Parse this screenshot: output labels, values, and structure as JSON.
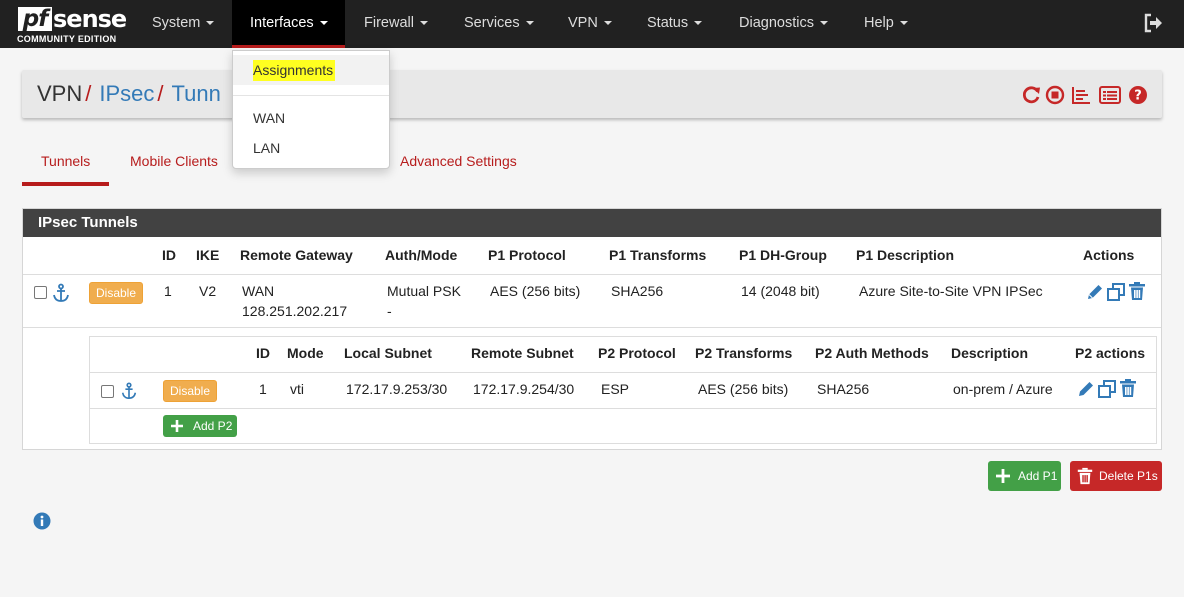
{
  "navbar": {
    "logo": {
      "mark": "pf",
      "word": "sense",
      "edition": "COMMUNITY EDITION"
    },
    "items": [
      {
        "label": "System"
      },
      {
        "label": "Interfaces"
      },
      {
        "label": "Firewall"
      },
      {
        "label": "Services"
      },
      {
        "label": "VPN"
      },
      {
        "label": "Status"
      },
      {
        "label": "Diagnostics"
      },
      {
        "label": "Help"
      }
    ],
    "active": "Interfaces",
    "logout_icon": "logout-icon"
  },
  "dropdown": {
    "items": [
      {
        "label": "Assignments",
        "highlighted": true
      },
      {
        "label": "WAN"
      },
      {
        "label": "LAN"
      }
    ]
  },
  "breadcrumb": {
    "parts": [
      "VPN",
      "IPsec",
      "Tunn"
    ],
    "separator": "/",
    "icons": [
      "reload-icon",
      "stop-icon",
      "chart-icon",
      "list-icon",
      "help-icon"
    ]
  },
  "tabs": [
    "Tunnels",
    "Mobile Clients",
    "Advanced Settings"
  ],
  "tunnels": {
    "title": "IPsec Tunnels",
    "columns": [
      "ID",
      "IKE",
      "Remote Gateway",
      "Auth/Mode",
      "P1 Protocol",
      "P1 Transforms",
      "P1 DH-Group",
      "P1 Description",
      "Actions"
    ],
    "row": {
      "disable_label": "Disable",
      "id": "1",
      "ike": "V2",
      "remote_gateway_1": "WAN",
      "remote_gateway_2": "128.251.202.217",
      "auth_mode_1": "Mutual PSK",
      "auth_mode_2": "-",
      "p1_protocol": "AES (256 bits)",
      "p1_transforms": "SHA256",
      "p1_dh_group": "14 (2048 bit)",
      "p1_description": "Azure Site-to-Site VPN IPSec"
    },
    "p2": {
      "columns": [
        "ID",
        "Mode",
        "Local Subnet",
        "Remote Subnet",
        "P2 Protocol",
        "P2 Transforms",
        "P2 Auth Methods",
        "Description",
        "P2 actions"
      ],
      "row": {
        "disable_label": "Disable",
        "id": "1",
        "mode": "vti",
        "local_subnet": "172.17.9.253/30",
        "remote_subnet": "172.17.9.254/30",
        "p2_protocol": "ESP",
        "p2_transforms": "AES (256 bits)",
        "p2_auth_methods": "SHA256",
        "description": "on-prem / Azure"
      },
      "add_label": "Add P2"
    }
  },
  "buttons": {
    "add_p1": "Add P1",
    "delete_p1s": "Delete P1s"
  },
  "colors": {
    "accent": "#b71c1c",
    "link": "#337ab7",
    "navbar": "#212121",
    "success": "#43a047",
    "danger": "#c62828",
    "warning": "#f0ad4e",
    "highlight": "#ffff20"
  }
}
